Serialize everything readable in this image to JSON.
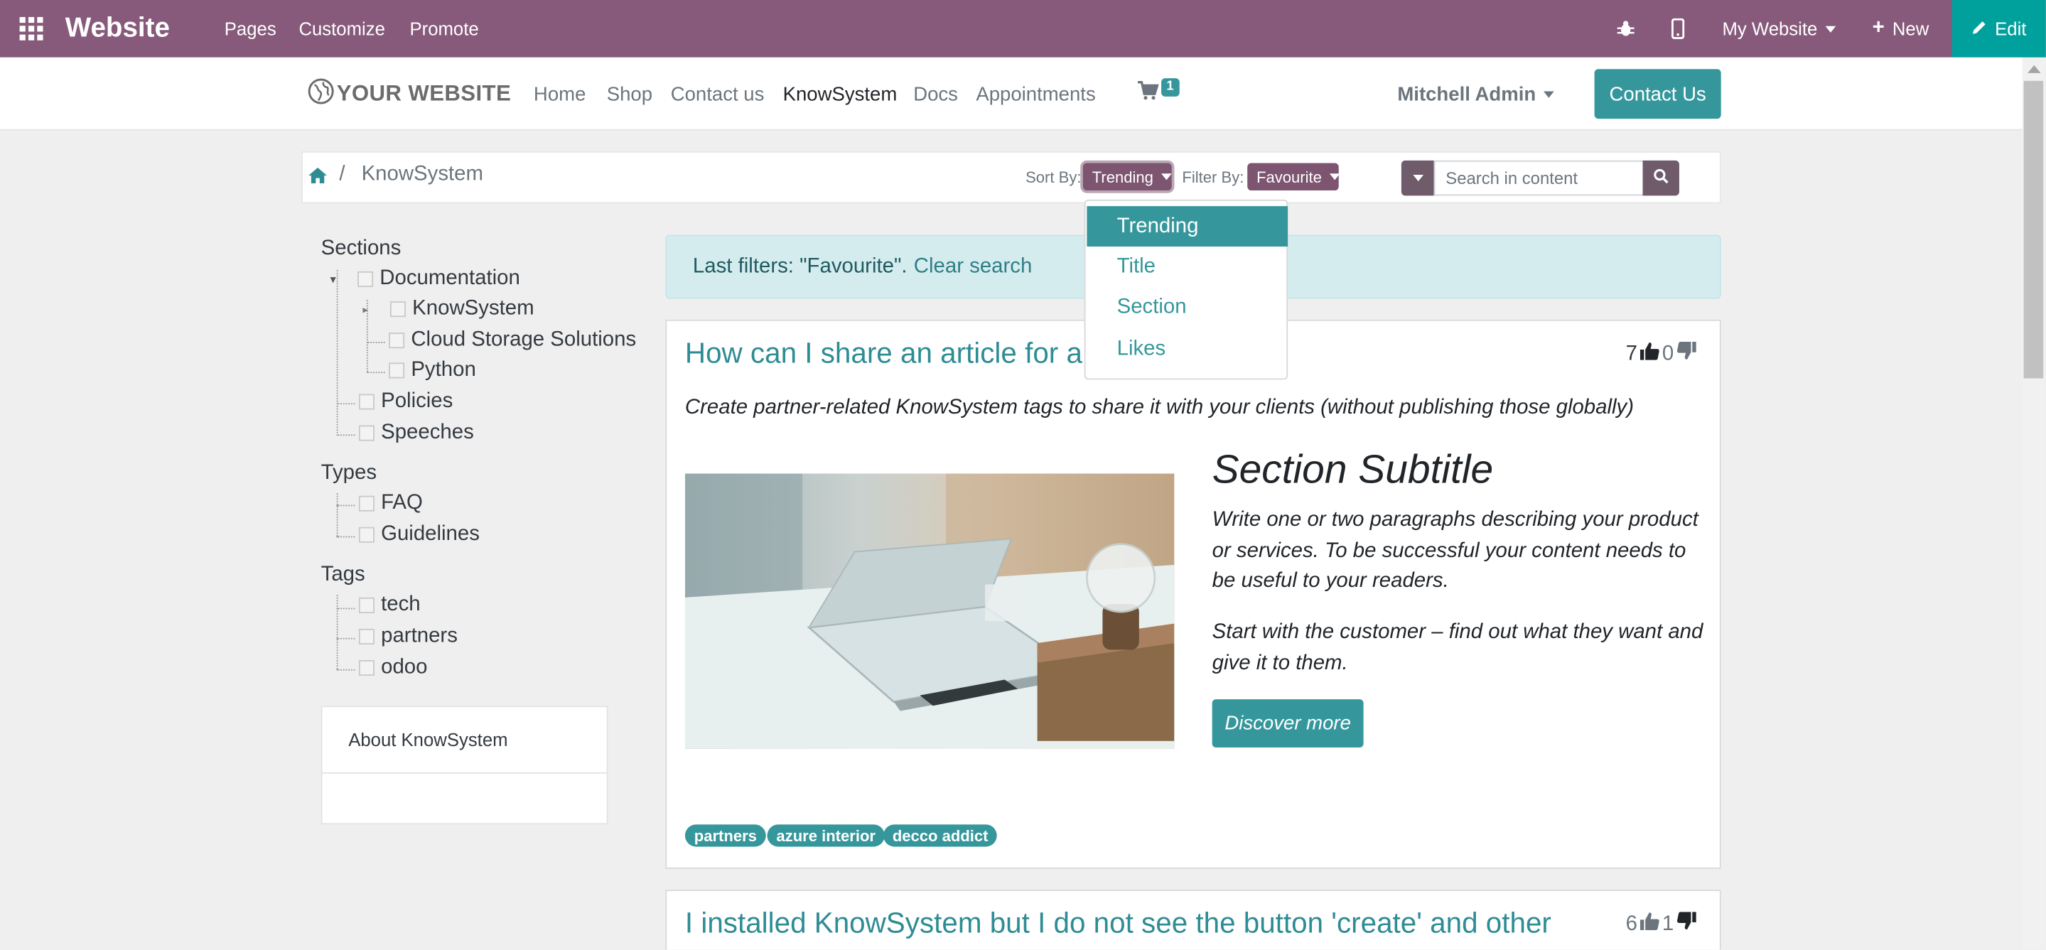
{
  "admin_bar": {
    "brand": "Website",
    "menu": [
      "Pages",
      "Customize",
      "Promote"
    ],
    "website_selector": "My Website",
    "new_label": "New",
    "edit_label": "Edit",
    "background_color": "#875a7b",
    "edit_color": "#00a09d"
  },
  "site_header": {
    "logo_text": "YOUR WEBSITE",
    "nav": [
      "Home",
      "Shop",
      "Contact us",
      "KnowSystem",
      "Docs",
      "Appointments"
    ],
    "active_nav": "KnowSystem",
    "cart_count": "1",
    "user_name": "Mitchell Admin",
    "contact_button": "Contact Us",
    "accent_color": "#35979c"
  },
  "toolbar": {
    "breadcrumb_current": "KnowSystem",
    "sort_label": "Sort By:",
    "sort_value": "Trending",
    "filter_label": "Filter By:",
    "filter_value": "Favourite",
    "search_placeholder": "Search in content"
  },
  "sort_menu": {
    "items": [
      "Trending",
      "Title",
      "Section",
      "Likes"
    ],
    "active": "Trending"
  },
  "sidebar": {
    "sections_title": "Sections",
    "sections": [
      {
        "label": "Documentation"
      },
      {
        "label": "KnowSystem"
      },
      {
        "label": "Cloud Storage Solutions"
      },
      {
        "label": "Python"
      },
      {
        "label": "Policies"
      },
      {
        "label": "Speeches"
      }
    ],
    "types_title": "Types",
    "types": [
      "FAQ",
      "Guidelines"
    ],
    "tags_title": "Tags",
    "tags": [
      "tech",
      "partners",
      "odoo"
    ],
    "about_title": "About KnowSystem"
  },
  "filter_alert": {
    "text": "Last filters: \"Favourite\".",
    "clear_link": "Clear search"
  },
  "articles": [
    {
      "title": "How can I share an article for a partner?",
      "likes": "7",
      "dislikes": "0",
      "description": "Create partner-related KnowSystem tags to share it with your clients (without publishing those globally)",
      "section_subtitle": "Section Subtitle",
      "paragraph_1": "Write one or two paragraphs describing your product or services. To be successful your content needs to be useful to your readers.",
      "paragraph_2": "Start with the customer – find out what they want and give it to them.",
      "button": "Discover more",
      "tags": [
        "partners",
        "azure interior",
        "decco addict"
      ]
    },
    {
      "title": "I installed KnowSystem but I do not see the button 'create' and other",
      "likes": "6",
      "dislikes": "1"
    }
  ]
}
